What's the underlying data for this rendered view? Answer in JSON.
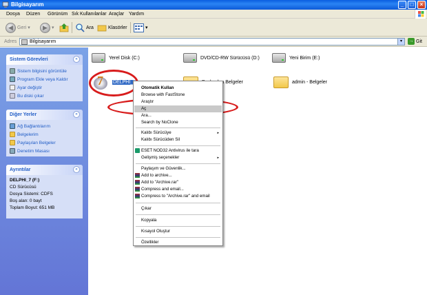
{
  "window": {
    "title": "Bilgisayarım",
    "colors": {
      "titlebar": "#0a5ee0",
      "panel": "#7ba2e7",
      "annotation": "#d81c1c",
      "link": "#215dc6",
      "selection": "#316ac5"
    },
    "controls": {
      "minimize": "_",
      "maximize": "□",
      "close": "×"
    }
  },
  "menubar": [
    "Dosya",
    "Düzen",
    "Görünüm",
    "Sık Kullanılanlar",
    "Araçlar",
    "Yardım"
  ],
  "toolbar": {
    "back": "Geri",
    "back_dropdown": "▾",
    "forward_dropdown": "▾",
    "search": "Ara",
    "folders": "Klasörler",
    "views_dropdown": "▾"
  },
  "addressbar": {
    "label": "Adres",
    "value": "Bilgisayarım",
    "dropdown": "▾",
    "go": "Git",
    "go_arrow": "→"
  },
  "sidebar": {
    "collapse_symbol": "«",
    "system_tasks": {
      "title": "Sistem Görevleri",
      "items": [
        "Sistem bilgisini görüntüle",
        "Program Ekle veya Kaldır",
        "Ayar değiştir",
        "Bu diski çıkar"
      ]
    },
    "other_places": {
      "title": "Diğer Yerler",
      "items": [
        "Ağ Bağlantılarım",
        "Belgelerim",
        "Paylaşılan Belgeler",
        "Denetim Masası"
      ]
    },
    "details": {
      "title": "Ayrıntılar",
      "name": "DELPHI_7 (F:)",
      "type": "CD Sürücüsü",
      "filesystem": "Dosya Sistemi: CDFS",
      "free": "Boş alan: 0 bayt",
      "total": "Toplam Boyut: 651 MB"
    }
  },
  "content": {
    "drives": [
      {
        "label": "Yerel Disk (C:)",
        "icon": "hard-drive-icon"
      },
      {
        "label": "DVD/CD-RW Sürücüsü (D:)",
        "icon": "cd-drive-icon"
      },
      {
        "label": "Yeni Birim (E:)",
        "icon": "hard-drive-icon"
      },
      {
        "label": "DELPHI_7",
        "icon": "delphi-cd-icon"
      }
    ],
    "folders": [
      {
        "label": "Paylaşılan Belgeler",
        "icon": "folder-icon"
      },
      {
        "label": "admin - Belgeler",
        "icon": "folder-icon"
      }
    ]
  },
  "context_menu": {
    "items": [
      {
        "label": "Otomatik Kullan",
        "bold": true
      },
      {
        "label": "Browse with FastStone"
      },
      {
        "label": "Araştır"
      },
      {
        "label": "Aç",
        "highlighted": true
      },
      {
        "label": "Ara..."
      },
      {
        "label": "Search by NoClone"
      },
      {
        "label": "Kalıbı Sürücüye",
        "submenu": true
      },
      {
        "label": "Kalıbı Sürücüden Sil"
      },
      {
        "label": "ESET NOD32 Antivirus ile tara",
        "icon": "eset-icon"
      },
      {
        "label": "Gelişmiş seçenekler",
        "submenu": true
      },
      {
        "label": "Paylaşım ve Güvenlik..."
      },
      {
        "label": "Add to archive...",
        "icon": "winrar-icon"
      },
      {
        "label": "Add to \"Archive.rar\"",
        "icon": "winrar-icon"
      },
      {
        "label": "Compress and email...",
        "icon": "winrar-icon"
      },
      {
        "label": "Compress to \"Archive.rar\" and email",
        "icon": "winrar-icon"
      },
      {
        "label": "Çıkar"
      },
      {
        "label": "Kopyala"
      },
      {
        "label": "Kısayol Oluştur"
      },
      {
        "label": "Özellikler"
      }
    ],
    "submenu_arrow": "▸"
  }
}
